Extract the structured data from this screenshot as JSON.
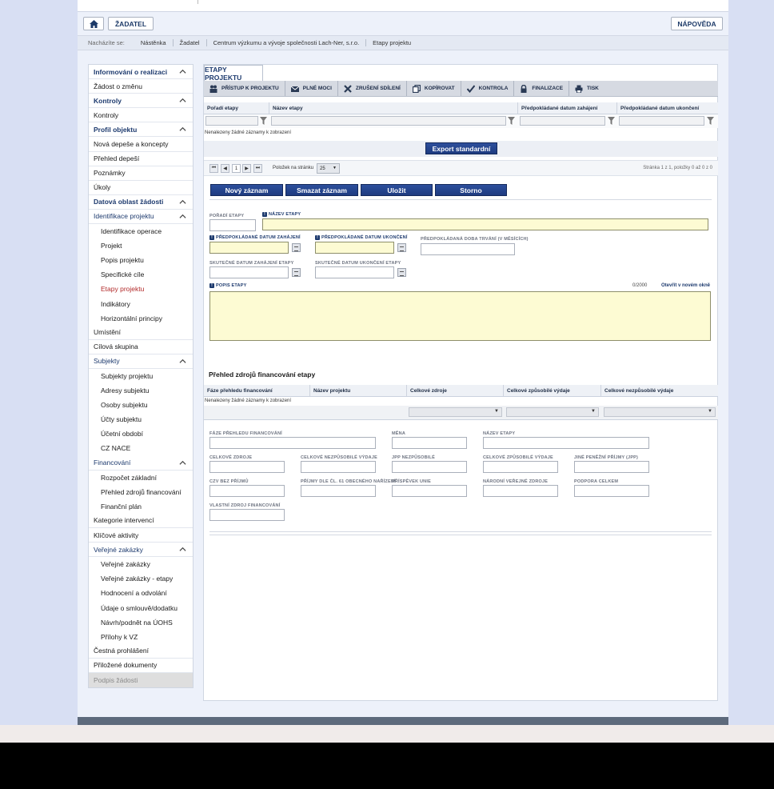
{
  "top": {
    "home_label": "",
    "zadatel_label": "ŽADATEL",
    "napoveda_label": "NÁPOVĚDA"
  },
  "breadcrumb": {
    "label": "Nacházíte se:",
    "items": [
      "Nástěnka",
      "Žadatel",
      "Centrum výzkumu a vývoje společnosti Lach-Ner, s.r.o.",
      "Etapy projektu"
    ]
  },
  "sidebar": {
    "items": [
      {
        "label": "Informování o realizaci",
        "type": "hdr"
      },
      {
        "label": "Žádost o změnu",
        "type": "item"
      },
      {
        "label": "Kontroly",
        "type": "hdr"
      },
      {
        "label": "Kontroly",
        "type": "item"
      },
      {
        "label": "Profil objektu",
        "type": "hdr"
      },
      {
        "label": "Nová depeše a koncepty",
        "type": "item"
      },
      {
        "label": "Přehled depeší",
        "type": "item"
      },
      {
        "label": "Poznámky",
        "type": "item"
      },
      {
        "label": "Úkoly",
        "type": "item"
      },
      {
        "label": "Datová oblast žádosti",
        "type": "hdr"
      },
      {
        "label": "Identifikace projektu",
        "type": "hdr-reg"
      },
      {
        "label": "Identifikace operace",
        "type": "sub"
      },
      {
        "label": "Projekt",
        "type": "sub"
      },
      {
        "label": "Popis projektu",
        "type": "sub"
      },
      {
        "label": "Specifické cíle",
        "type": "sub"
      },
      {
        "label": "Etapy projektu",
        "type": "sub-active"
      },
      {
        "label": "Indikátory",
        "type": "sub"
      },
      {
        "label": "Horizontální principy",
        "type": "sub"
      },
      {
        "label": "Umístění",
        "type": "item"
      },
      {
        "label": "Cílová skupina",
        "type": "item"
      },
      {
        "label": "Subjekty",
        "type": "hdr-reg"
      },
      {
        "label": "Subjekty projektu",
        "type": "sub"
      },
      {
        "label": "Adresy subjektu",
        "type": "sub"
      },
      {
        "label": "Osoby subjektu",
        "type": "sub"
      },
      {
        "label": "Účty subjektu",
        "type": "sub"
      },
      {
        "label": "Účetní období",
        "type": "sub"
      },
      {
        "label": "CZ NACE",
        "type": "sub"
      },
      {
        "label": "Financování",
        "type": "hdr-reg"
      },
      {
        "label": "Rozpočet základní",
        "type": "sub"
      },
      {
        "label": "Přehled zdrojů financování",
        "type": "sub"
      },
      {
        "label": "Finanční plán",
        "type": "sub"
      },
      {
        "label": "Kategorie intervencí",
        "type": "item"
      },
      {
        "label": "Klíčové aktivity",
        "type": "item"
      },
      {
        "label": "Veřejné zakázky",
        "type": "hdr-reg"
      },
      {
        "label": "Veřejné zakázky",
        "type": "sub"
      },
      {
        "label": "Veřejné zakázky - etapy",
        "type": "sub"
      },
      {
        "label": "Hodnocení a odvolání",
        "type": "sub"
      },
      {
        "label": "Údaje o smlouvě/dodatku",
        "type": "sub"
      },
      {
        "label": "Návrh/podnět na ÚOHS",
        "type": "sub"
      },
      {
        "label": "Přílohy k VZ",
        "type": "sub"
      },
      {
        "label": "Čestná prohlášení",
        "type": "item"
      },
      {
        "label": "Přiložené dokumenty",
        "type": "item"
      },
      {
        "label": "Podpis žádosti",
        "type": "disabled"
      }
    ]
  },
  "tab": {
    "label": "ETAPY PROJEKTU"
  },
  "toolbar": {
    "pristup": "PŘÍSTUP K PROJEKTU",
    "plne_moci": "PLNÉ MOCI",
    "zruseni": "ZRUŠENÍ SDÍLENÍ",
    "kopirovat": "KOPÍROVAT",
    "kontrola": "KONTROLA",
    "finalizace": "FINALIZACE",
    "tisk": "TISK"
  },
  "grid": {
    "columns": [
      "Pořadí etapy",
      "Název etapy",
      "Předpokládané datum zahájení",
      "Předpokládané datum ukončení"
    ],
    "no_data": "Nenalezeny žádné záznamy k zobrazení"
  },
  "export_label": "Export standardní",
  "pager": {
    "first": "⏮",
    "prev": "◀",
    "page": "1",
    "next": "▶",
    "last": "⏭",
    "per_page_label": "Položek na stránku",
    "per_page": "25",
    "summary": "Stránka 1 z 1, položky 0 až 0 z 0"
  },
  "actions": {
    "new": "Nový záznam",
    "delete": "Smazat záznam",
    "save": "Uložit",
    "cancel": "Storno"
  },
  "form": {
    "poradi": "POŘADÍ ETAPY",
    "nazev": "NÁZEV ETAPY",
    "pred_zahajeni": "PŘEDPOKLÁDANÉ DATUM ZAHÁJENÍ",
    "pred_ukonceni": "PŘEDPOKLÁDANÉ DATUM UKONČENÍ",
    "doba": "PŘEDPOKLÁDANÁ DOBA TRVÁNÍ (V MĚSÍCÍCH)",
    "skut_zahajeni": "SKUTEČNÉ DATUM ZAHÁJENÍ ETAPY",
    "skut_ukonceni": "SKUTEČNÉ DATUM UKONČENÍ ETAPY",
    "popis": "POPIS ETAPY",
    "counter": "0/2000",
    "open_new": "Otevřít v novém okně",
    "req_mark": "!"
  },
  "fin": {
    "title": "Přehled zdrojů financování etapy",
    "columns": [
      "Fáze přehledu financování",
      "Název projektu",
      "Celkové zdroje",
      "Celkové způsobilé výdaje",
      "Celkové nezpůsobilé výdaje"
    ],
    "no_data": "Nenalezeny žádné záznamy k zobrazení",
    "dd_arrow": "▼",
    "fields": {
      "faze": "FÁZE PŘEHLEDU FINANCOVÁNÍ",
      "mena": "MĚNA",
      "nazev": "NÁZEV ETAPY",
      "celk_zdroje": "CELKOVÉ ZDROJE",
      "celk_nezpus": "CELKOVÉ NEZPŮSOBILÉ VÝDAJE",
      "jpp_nezpus": "JPP NEZPŮSOBILÉ",
      "celk_zpus": "CELKOVÉ ZPŮSOBILÉ VÝDAJE",
      "jine_prijmy": "JINÉ PENĚŽNÍ PŘÍJMY (JPP)",
      "czv_bez": "CZV BEZ PŘÍJMŮ",
      "prijmy61": "PŘÍJMY DLE ČL. 61 OBECNÉHO NAŘÍZENÍ",
      "prispevek": "PŘÍSPĚVEK UNIE",
      "narodni": "NÁRODNÍ VEŘEJNÉ ZDROJE",
      "podpora": "PODPORA CELKEM",
      "vlastni": "VLASTNÍ ZDROJ FINANCOVÁNÍ"
    }
  }
}
